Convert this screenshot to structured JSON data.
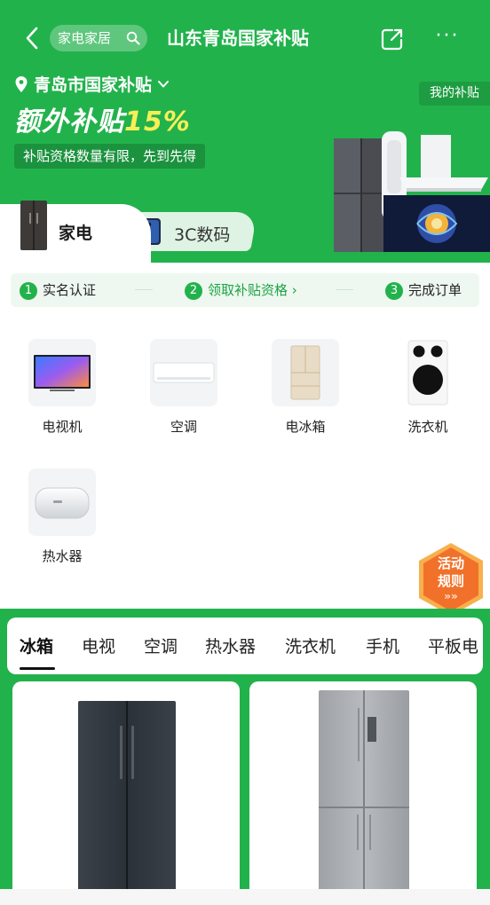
{
  "header": {
    "search_label": "家电家居",
    "title": "山东青岛国家补贴",
    "more_label": "···"
  },
  "banner": {
    "city": "青岛市国家补贴",
    "my_subsidy": "我的补贴",
    "extra_prefix": "额外补贴",
    "extra_percent": "15%",
    "limit_note": "补贴资格数量有限，先到先得"
  },
  "category_tabs": [
    {
      "label": "家电",
      "active": true
    },
    {
      "label": "3C数码",
      "active": false
    }
  ],
  "steps": [
    {
      "num": "1",
      "label": "实名认证"
    },
    {
      "num": "2",
      "label": "领取补贴资格 ›"
    },
    {
      "num": "3",
      "label": "完成订单"
    }
  ],
  "appliances": [
    {
      "name": "电视机",
      "icon": "tv-icon"
    },
    {
      "name": "空调",
      "icon": "air-conditioner-icon"
    },
    {
      "name": "电冰箱",
      "icon": "fridge-icon"
    },
    {
      "name": "洗衣机",
      "icon": "washing-machine-icon"
    },
    {
      "name": "热水器",
      "icon": "water-heater-icon"
    }
  ],
  "rules_button": {
    "line1": "活动",
    "line2": "规则",
    "arrows": "»»"
  },
  "product_tabs": [
    "冰箱",
    "电视",
    "空调",
    "热水器",
    "洗衣机",
    "手机",
    "平板电"
  ],
  "colors": {
    "brand_green": "#22b24c",
    "accent_yellow": "#f8ef57",
    "rules_orange": "#f2712a"
  }
}
